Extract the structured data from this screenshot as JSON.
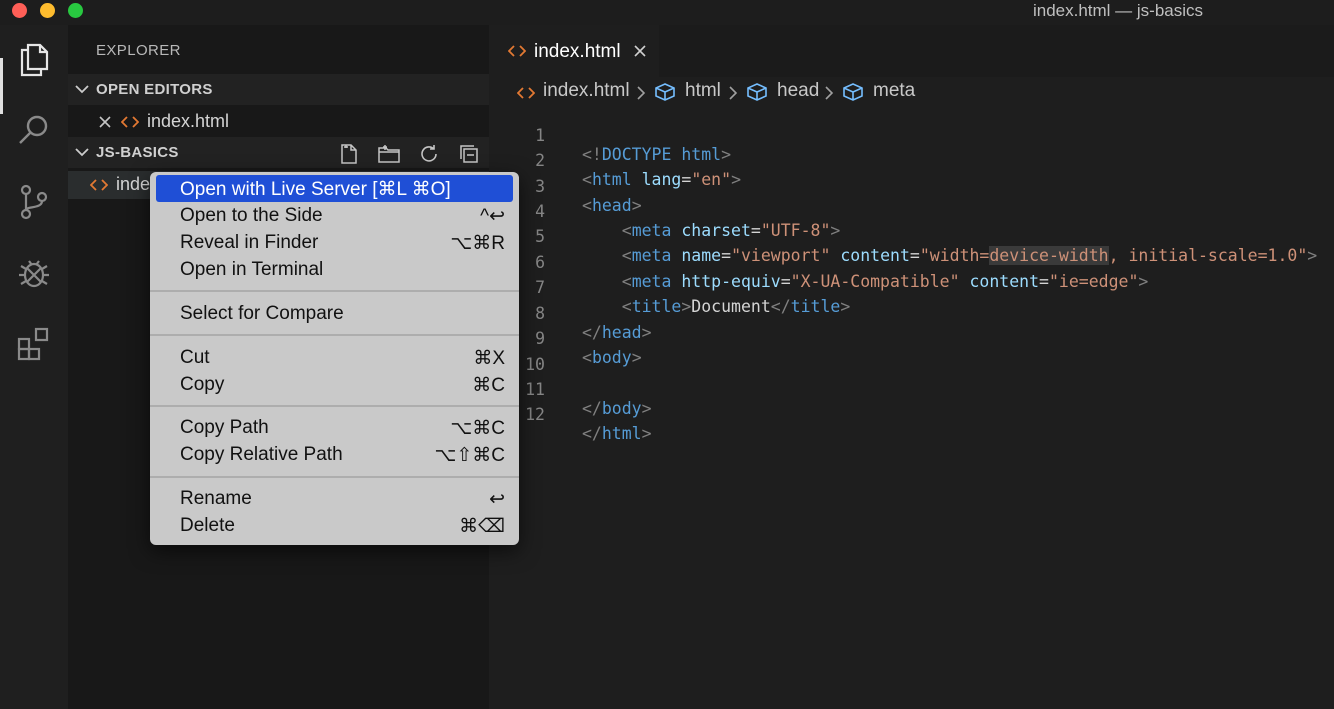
{
  "window": {
    "title": "index.html — js-basics"
  },
  "activity_bar": {
    "items": [
      {
        "name": "explorer",
        "icon": "files-icon",
        "active": true
      },
      {
        "name": "search",
        "icon": "search-icon"
      },
      {
        "name": "source-control",
        "icon": "source-control-icon"
      },
      {
        "name": "debug",
        "icon": "debug-icon"
      },
      {
        "name": "extensions",
        "icon": "extensions-icon"
      }
    ]
  },
  "sidebar": {
    "title": "EXPLORER",
    "open_editors": {
      "label": "OPEN EDITORS",
      "files": [
        "index.html"
      ]
    },
    "project": {
      "label": "JS-BASICS",
      "file_partial": "inde"
    }
  },
  "editor": {
    "tab": {
      "label": "index.html"
    },
    "breadcrumbs": [
      "index.html",
      "html",
      "head",
      "meta"
    ],
    "line_numbers": [
      "1",
      "2",
      "3",
      "4",
      "5",
      "6",
      "7",
      "8",
      "9",
      "10",
      "11",
      "12"
    ],
    "code": {
      "l1": {
        "open": "<!",
        "tag": "DOCTYPE",
        "attr": "html",
        "close": ">"
      },
      "l2": {
        "open": "<",
        "tag": "html",
        "attr": "lang",
        "eq": "=",
        "val": "\"en\"",
        "close": ">"
      },
      "l3": {
        "open": "<",
        "tag": "head",
        "close": ">"
      },
      "l4": {
        "indent": "    ",
        "open": "<",
        "tag": "meta",
        "attr": "charset",
        "eq": "=",
        "val": "\"UTF-8\"",
        "close": ">"
      },
      "l5": {
        "indent": "    ",
        "open": "<",
        "tag": "meta",
        "attr1": "name",
        "eq": "=",
        "val1": "\"viewport\"",
        "attr2": "content",
        "val2a": "\"width=",
        "val2b": "device-width",
        "val2c": ", initial-scale=1.0\"",
        "close": ">"
      },
      "l6": {
        "indent": "    ",
        "open": "<",
        "tag": "meta",
        "attr1": "http-equiv",
        "eq": "=",
        "val1": "\"X-UA-Compatible\"",
        "attr2": "content",
        "val2": "\"ie=edge\"",
        "close": ">"
      },
      "l7": {
        "indent": "    ",
        "open": "<",
        "tag": "title",
        "close": ">",
        "text": "Document",
        "end_open": "</",
        "end_tag": "title",
        "end_close": ">"
      },
      "l8": {
        "open": "</",
        "tag": "head",
        "close": ">"
      },
      "l9": {
        "open": "<",
        "tag": "body",
        "close": ">"
      },
      "l10": {
        "text": ""
      },
      "l11": {
        "open": "</",
        "tag": "body",
        "close": ">"
      },
      "l12": {
        "open": "</",
        "tag": "html",
        "close": ">"
      }
    }
  },
  "context_menu": {
    "items": [
      {
        "label": "Open with Live Server [⌘L ⌘O]",
        "shortcut": "",
        "highlighted": true
      },
      {
        "label": "Open to the Side",
        "shortcut": "^↩"
      },
      {
        "label": "Reveal in Finder",
        "shortcut": "⌥⌘R"
      },
      {
        "label": "Open in Terminal",
        "shortcut": ""
      },
      {
        "label": "Select for Compare",
        "shortcut": ""
      },
      {
        "label": "Cut",
        "shortcut": "⌘X"
      },
      {
        "label": "Copy",
        "shortcut": "⌘C"
      },
      {
        "label": "Copy Path",
        "shortcut": "⌥⌘C"
      },
      {
        "label": "Copy Relative Path",
        "shortcut": "⌥⇧⌘C"
      },
      {
        "label": "Rename",
        "shortcut": "↩"
      },
      {
        "label": "Delete",
        "shortcut": "⌘⌫"
      }
    ]
  },
  "colors": {
    "accent_highlight": "#1f4fd6",
    "tag_blue": "#569cd6",
    "attr_lightblue": "#9cdcfe",
    "string_orange": "#ce9178",
    "html_icon_orange": "#e37933",
    "cube_icon_blue": "#75beff"
  }
}
